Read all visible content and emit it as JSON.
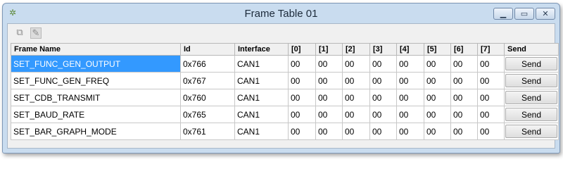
{
  "window": {
    "title": "Frame Table 01"
  },
  "columns": [
    "Frame Name",
    "Id",
    "Interface",
    "[0]",
    "[1]",
    "[2]",
    "[3]",
    "[4]",
    "[5]",
    "[6]",
    "[7]",
    "Send"
  ],
  "rows": [
    {
      "name": "SET_FUNC_GEN_OUTPUT",
      "id": "0x766",
      "iface": "CAN1",
      "bytes": [
        "00",
        "00",
        "00",
        "00",
        "00",
        "00",
        "00",
        "00"
      ],
      "send": "Send"
    },
    {
      "name": "SET_FUNC_GEN_FREQ",
      "id": "0x767",
      "iface": "CAN1",
      "bytes": [
        "00",
        "00",
        "00",
        "00",
        "00",
        "00",
        "00",
        "00"
      ],
      "send": "Send"
    },
    {
      "name": "SET_CDB_TRANSMIT",
      "id": "0x760",
      "iface": "CAN1",
      "bytes": [
        "00",
        "00",
        "00",
        "00",
        "00",
        "00",
        "00",
        "00"
      ],
      "send": "Send"
    },
    {
      "name": "SET_BAUD_RATE",
      "id": "0x765",
      "iface": "CAN1",
      "bytes": [
        "00",
        "00",
        "00",
        "00",
        "00",
        "00",
        "00",
        "00"
      ],
      "send": "Send"
    },
    {
      "name": "SET_BAR_GRAPH_MODE",
      "id": "0x761",
      "iface": "CAN1",
      "bytes": [
        "00",
        "00",
        "00",
        "00",
        "00",
        "00",
        "00",
        "00"
      ],
      "send": "Send"
    }
  ],
  "selected_row": 0,
  "icons": {
    "app": "gear-icon",
    "toolbar_1": "new-frame-icon",
    "toolbar_2": "edit-frame-icon"
  },
  "colors": {
    "selection": "#3399ff",
    "title_bar": "#c9dcef"
  }
}
